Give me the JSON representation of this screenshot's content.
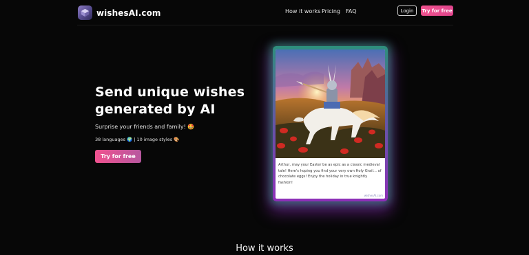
{
  "header": {
    "logo_text": "wishesAI.com",
    "nav": {
      "how_it_works": "How it works",
      "pricing": "Pricing",
      "faq": "FAQ"
    },
    "login_label": "Login",
    "try_label": "Try for free"
  },
  "hero": {
    "title_line1": "Send unique wishes",
    "title_line2": "generated by AI",
    "subtitle": "Surprise your friends and family! 🤩",
    "stats": "38 languages 🌍 | 10 image styles 🎨",
    "cta_label": "Try for free"
  },
  "card": {
    "message": "Arthur, may your Easter be as epic as a classic medieval tale! Here's hoping you find your very own Holy Grail... of chocolate eggs! Enjoy the holiday in true knightly fashion!",
    "watermark": "wishesAI.com"
  },
  "section": {
    "how_it_works_title": "How it works"
  },
  "colors": {
    "background": "#070707",
    "accent_pink": "#f0528f",
    "accent_purple": "#b7579f"
  }
}
